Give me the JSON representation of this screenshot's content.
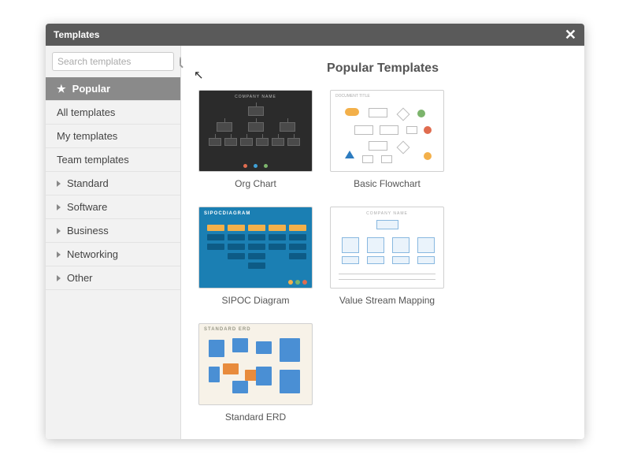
{
  "titlebar": {
    "title": "Templates"
  },
  "search": {
    "placeholder": "Search templates"
  },
  "sidebar": {
    "items": [
      {
        "label": "Popular",
        "type": "star",
        "selected": true
      },
      {
        "label": "All templates",
        "type": "plain"
      },
      {
        "label": "My templates",
        "type": "plain"
      },
      {
        "label": "Team templates",
        "type": "plain"
      },
      {
        "label": "Standard",
        "type": "caret"
      },
      {
        "label": "Software",
        "type": "caret"
      },
      {
        "label": "Business",
        "type": "caret"
      },
      {
        "label": "Networking",
        "type": "caret"
      },
      {
        "label": "Other",
        "type": "caret"
      }
    ]
  },
  "main": {
    "heading": "Popular Templates",
    "templates": [
      {
        "label": "Org Chart",
        "thumb_title": "COMPANY NAME"
      },
      {
        "label": "Basic Flowchart",
        "thumb_title": "DOCUMENT TITLE"
      },
      {
        "label": "SIPOC Diagram",
        "thumb_title": "SIPOCDIAGRAM"
      },
      {
        "label": "Value Stream Mapping",
        "thumb_title": "COMPANY NAME"
      },
      {
        "label": "Standard ERD",
        "thumb_title": "STANDARD ERD"
      }
    ]
  }
}
